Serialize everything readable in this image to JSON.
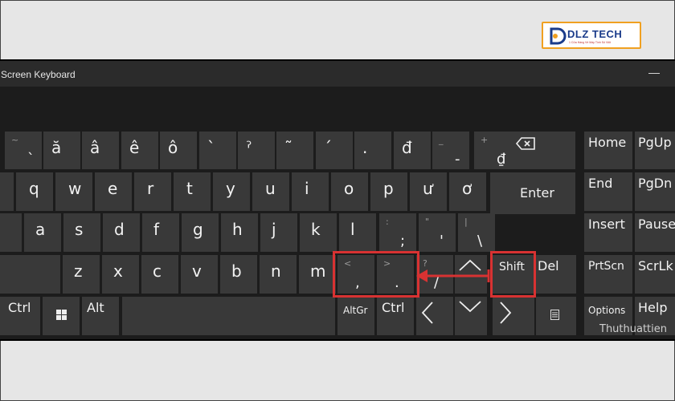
{
  "logo": {
    "title": "DLZ TECH",
    "subtitle": "1 Cửa Hàng Về Máy Tính Số Việt"
  },
  "window": {
    "title": "Screen Keyboard",
    "minimize_glyph": "—"
  },
  "rows": {
    "r1": [
      {
        "shift": "~",
        "base": "`",
        "label": ""
      },
      {
        "label": "ă"
      },
      {
        "label": "â"
      },
      {
        "label": "ê"
      },
      {
        "label": "ô"
      },
      {
        "label": "`"
      },
      {
        "label": "ˀ"
      },
      {
        "label": "˜"
      },
      {
        "label": "´"
      },
      {
        "label": "."
      },
      {
        "label": "đ"
      },
      {
        "shift": "_",
        "base": "-",
        "label": ""
      },
      {
        "shift": "+",
        "base": "₫",
        "label": ""
      }
    ],
    "r2": [
      "q",
      "w",
      "e",
      "r",
      "t",
      "y",
      "u",
      "i",
      "o",
      "p",
      "ư",
      "ơ"
    ],
    "r3": [
      "a",
      "s",
      "d",
      "f",
      "g",
      "h",
      "j",
      "k",
      "l"
    ],
    "r3_extra": [
      {
        "shift": ":",
        "base": ";"
      },
      {
        "shift": "\"",
        "base": "'"
      },
      {
        "shift": "|",
        "base": "\\"
      }
    ],
    "r4": [
      "z",
      "x",
      "c",
      "v",
      "b",
      "n",
      "m"
    ],
    "r4_extra": [
      {
        "shift": "<",
        "base": ","
      },
      {
        "shift": ">",
        "base": "."
      },
      {
        "shift": "?",
        "base": "/"
      }
    ]
  },
  "keys": {
    "enter": "Enter",
    "shift": "Shift",
    "del": "Del",
    "ctrl_left": "Ctrl",
    "alt": "Alt",
    "altgr": "AltGr",
    "ctrl_right": "Ctrl",
    "home": "Home",
    "pgup": "PgUp",
    "end": "End",
    "pgdn": "PgDn",
    "insert": "Insert",
    "pause": "Pause",
    "prtscn": "PrtScn",
    "scrlk": "ScrLk",
    "options": "Options",
    "help": "Help"
  },
  "watermark": "Thuthuattien",
  "colors": {
    "key": "#393939",
    "panel": "#1c1c1c",
    "highlight": "#d83232"
  }
}
